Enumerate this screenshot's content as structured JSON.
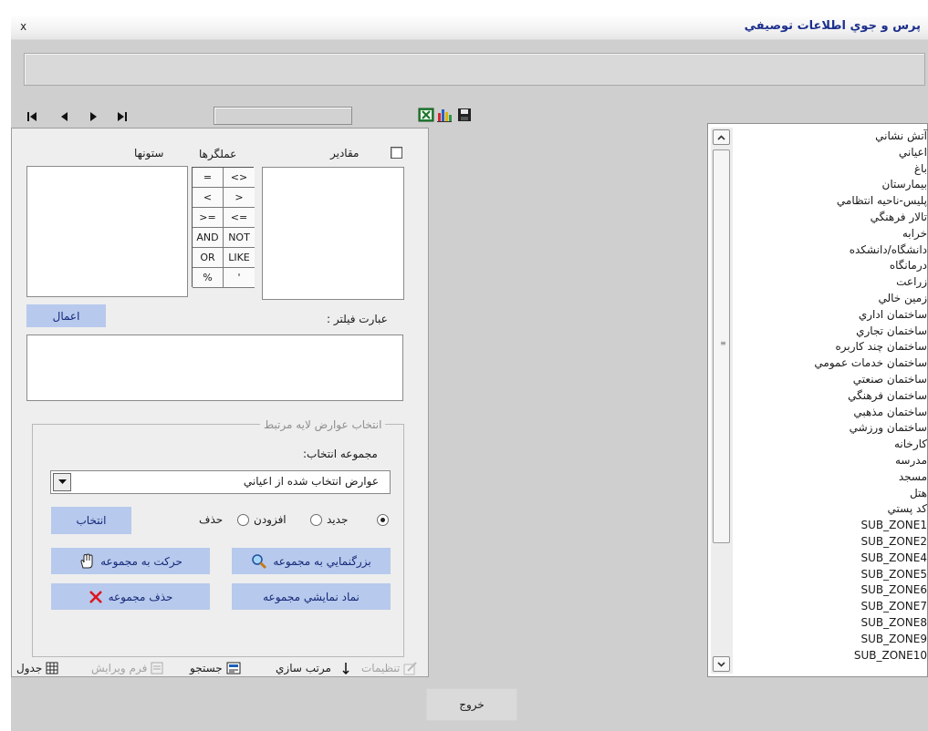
{
  "window": {
    "title": "پرس و جوي اطلاعات توصيفي",
    "close_label": "x"
  },
  "toolbar": {
    "nav": [
      "first-record",
      "previous-record",
      "next-record",
      "last-record"
    ],
    "icons": [
      "excel-icon",
      "chart-icon",
      "save-icon"
    ]
  },
  "query": {
    "columns_label": "ستونها",
    "operators_label": "عملگرها",
    "values_label": "مقادير",
    "values_checked": false,
    "operators": [
      "=",
      "<>",
      "<",
      ">",
      ">=",
      "<=",
      "AND",
      "NOT",
      "OR",
      "LIKE",
      "%",
      "'"
    ],
    "apply_button": "اعمال",
    "filter_label": "عبارت فيلتر :",
    "filter_text": ""
  },
  "selection": {
    "group_title": "انتخاب عوارض لايه مرتبط",
    "set_label": "مجموعه انتخاب:",
    "set_value": "عوارض انتخاب شده از اعياني",
    "radio_new": "جديد",
    "radio_add": "افزودن",
    "radio_remove": "حذف",
    "selected_mode": "new",
    "select_button": "انتخاب",
    "zoom_button": "بزرگنمايي به مجموعه",
    "pan_button": "حرکت به مجموعه",
    "symbol_button": "نماد نمايشي مجموعه",
    "delete_button": "حذف مجموعه"
  },
  "layers": [
    "آتش نشاني",
    "اعياني",
    "باغ",
    "بيمارستان",
    "پليس-ناحيه انتظامي",
    "تالار فرهنگي",
    "خرابه",
    "دانشگاه/دانشکده",
    "درمانگاه",
    "زراعت",
    "زمين خالي",
    "ساختمان اداري",
    "ساختمان تجاري",
    "ساختمان چند کاربره",
    "ساختمان خدمات عمومي",
    "ساختمان صنعتي",
    "ساختمان فرهنگي",
    "ساختمان مذهبي",
    "ساختمان ورزشي",
    "کارخانه",
    "مدرسه",
    "مسجد",
    "هتل",
    "کد پستي",
    "SUB_ZONE1",
    "SUB_ZONE2",
    "SUB_ZONE4",
    "SUB_ZONE5",
    "SUB_ZONE6",
    "SUB_ZONE7",
    "SUB_ZONE8",
    "SUB_ZONE9",
    "SUB_ZONE10"
  ],
  "tabs": {
    "table": "جدول",
    "form_edit": "فرم ويرايش",
    "search": "جستجو",
    "sort": "مرتب سازي",
    "settings": "تنظيمات"
  },
  "exit_button": "خروج",
  "colors": {
    "title_text": "#1c2f8c",
    "button_bg": "#b7c9ec",
    "button_text": "#15297a",
    "panel_gray": "#cfcfcf"
  }
}
